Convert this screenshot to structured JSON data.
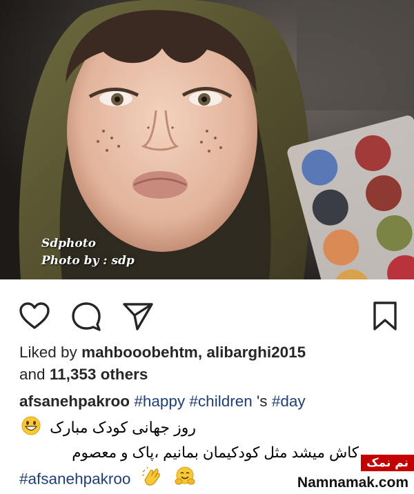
{
  "post": {
    "photo": {
      "watermark_line1": "Sdphoto",
      "watermark_line2": "Photo by : sdp"
    },
    "actions": {
      "like_icon": "heart-icon",
      "comment_icon": "comment-bubble-icon",
      "share_icon": "paper-plane-icon",
      "save_icon": "bookmark-icon"
    },
    "likes": {
      "prefix": "Liked by",
      "user1": "mahbooobehtm,",
      "user2": "alibarghi2015",
      "and": "and",
      "count_text": "11,353 others"
    },
    "caption": {
      "username": "afsanehpakroo",
      "tag1": "#happy",
      "tag2": "#children",
      "plain1": "'s",
      "tag3": "#day",
      "line2": "روز جهانی کودک مبارک",
      "line3": "کاش میشد مثل کودکیمان بمانیم ،پاک و معصوم",
      "tag4": "#afsanehpakroo"
    }
  },
  "branding": {
    "label": "نم نمک",
    "site": "Namnamak.com"
  },
  "colors": {
    "hashtag": "#1e3e7a",
    "text": "#262626",
    "brand_red": "#c40000"
  }
}
